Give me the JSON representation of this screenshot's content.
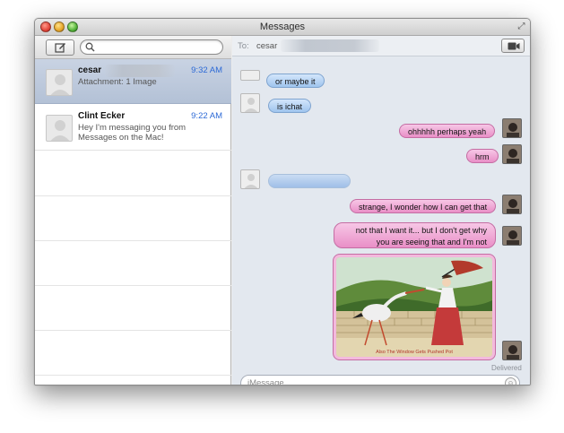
{
  "window": {
    "title": "Messages"
  },
  "sidebar": {
    "search_placeholder": "",
    "conversations": [
      {
        "name": "cesar",
        "time": "9:32 AM",
        "preview": "Attachment: 1 Image",
        "selected": true
      },
      {
        "name": "Clint Ecker",
        "time": "9:22 AM",
        "preview": "Hey I'm messaging you from Messages on the Mac!",
        "selected": false
      }
    ]
  },
  "conversation": {
    "to_label": "To:",
    "to_name": "cesar",
    "messages": [
      {
        "from": "them",
        "text": "or maybe it"
      },
      {
        "from": "them",
        "text": "is ichat"
      },
      {
        "from": "me",
        "text": "ohhhhh perhaps yeah"
      },
      {
        "from": "me",
        "text": "hrm"
      },
      {
        "from": "them",
        "text": ""
      },
      {
        "from": "me",
        "text": "strange, I wonder how I can get that"
      },
      {
        "from": "me",
        "text": "not that I want it... but I don't get why you are seeing that and I'm not"
      },
      {
        "from": "me",
        "type": "image",
        "caption": "Also The Window Gets Pushed Pot"
      }
    ],
    "status": "Delivered",
    "input_placeholder": "iMessage"
  },
  "colors": {
    "outgoing_bubble": "#e98fc7",
    "incoming_bubble": "#9fc4ee",
    "time_blue": "#2d6ad6",
    "selected_row": "#b3c1d6"
  },
  "icons": {
    "compose": "compose-icon",
    "search": "search-icon",
    "video": "video-camera-icon",
    "emoji": "emoji-icon",
    "fullscreen": "fullscreen-icon"
  }
}
